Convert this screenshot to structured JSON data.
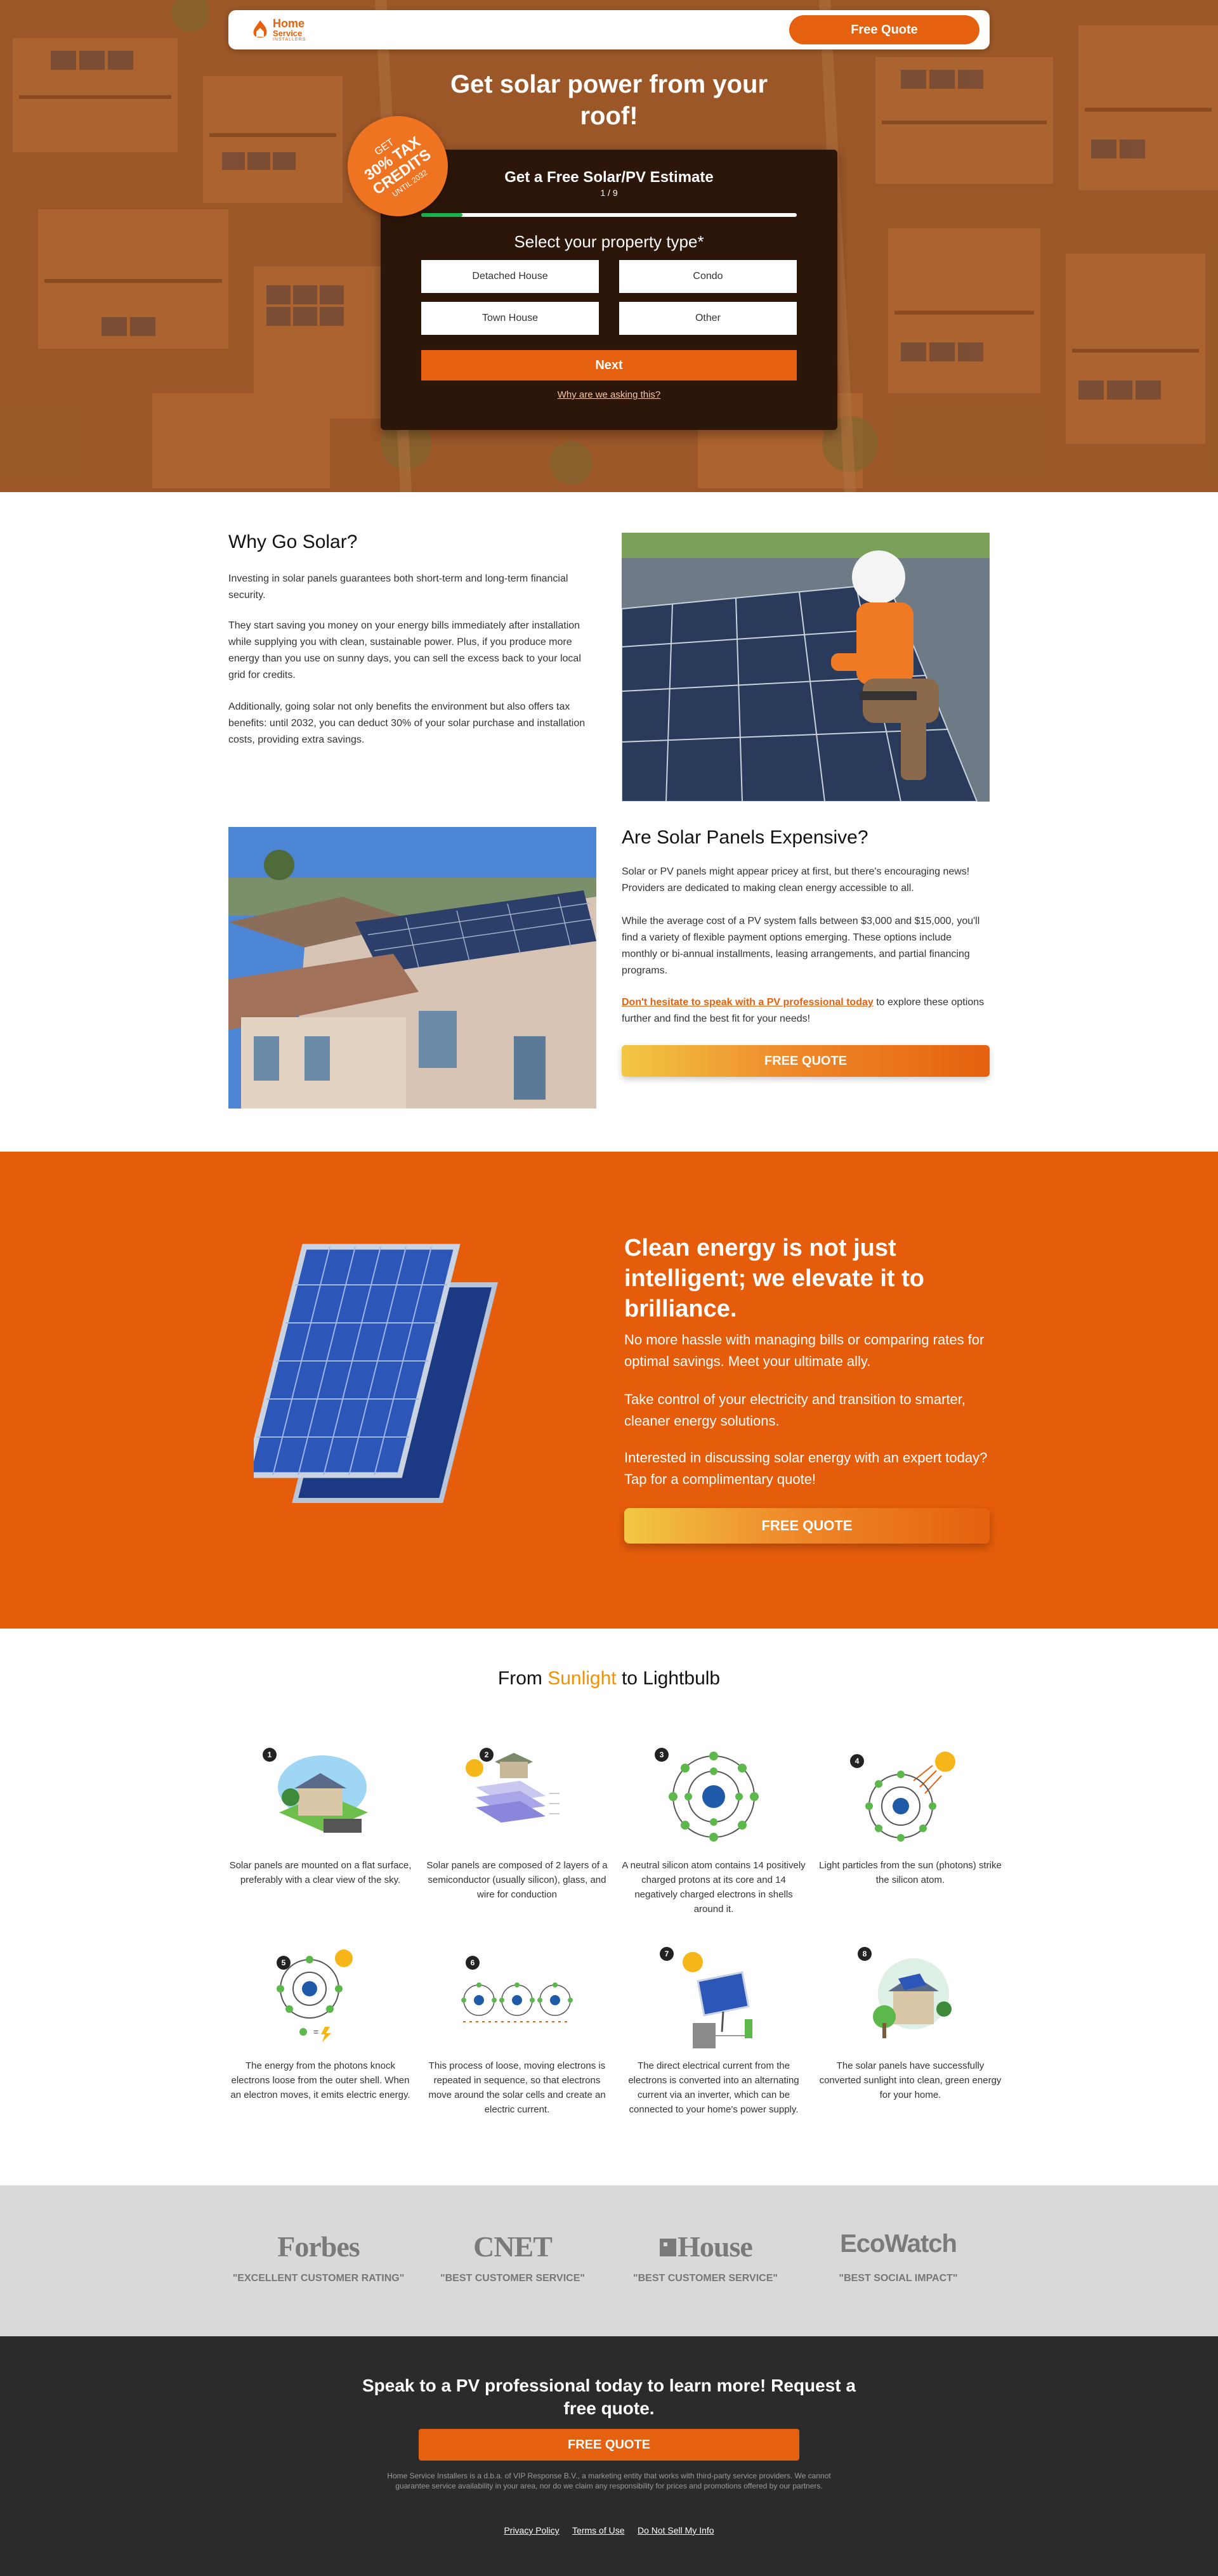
{
  "brand": {
    "name_line1": "Home",
    "name_line2": "Service",
    "name_line3": "INSTALLERS"
  },
  "header": {
    "cta_label": "Free Quote"
  },
  "hero": {
    "title": "Get solar power from your roof!",
    "badge": {
      "line1": "GET",
      "line2": "30% TAX",
      "line3": "CREDITS",
      "line4": "UNTIL 2032"
    },
    "form": {
      "title": "Get a Free Solar/PV Estimate",
      "step": "1 / 9",
      "progress_fraction": 0.11,
      "question": "Select your property type*",
      "options": [
        "Detached House",
        "Condo",
        "Town House",
        "Other"
      ],
      "next_label": "Next",
      "why_label": "Why are we asking this?"
    }
  },
  "why_solar": {
    "title": "Why Go Solar?",
    "p1": "Investing in solar panels guarantees both short-term and long-term financial security.",
    "p2": "They start saving you money on your energy bills immediately after installation while supplying you with clean, sustainable power. Plus, if you produce more energy than you use on sunny days, you can sell the excess back to your local grid for credits.",
    "p3": "Additionally, going solar not only benefits the environment but also offers tax benefits: until 2032, you can deduct 30% of your solar purchase and installation costs, providing extra savings."
  },
  "expensive": {
    "title": "Are Solar Panels Expensive?",
    "p1": "Solar or PV panels might appear pricey at first, but there's encouraging news! Providers are dedicated to making clean energy accessible to all.",
    "p2": "While the average cost of a PV system falls between $3,000 and $15,000, you'll find a variety of flexible payment options emerging. These options include monthly or bi-annual installments, leasing arrangements, and partial financing programs.",
    "p3_link": "Don't hesitate to speak with a PV professional today",
    "p3_rest": " to explore these options further and find the best fit for your needs!",
    "cta_label": "FREE QUOTE"
  },
  "clean_energy": {
    "title": "Clean energy is not just intelligent; we elevate it to brilliance.",
    "p1": "No more hassle with managing bills or comparing rates for optimal savings. Meet your ultimate ally.",
    "p2": "Take control of your electricity and transition to smarter, cleaner energy solutions.",
    "p3": "Interested in discussing solar energy with an expert today? Tap for a complimentary quote!",
    "cta_label": "FREE QUOTE"
  },
  "steps": {
    "title_prefix": "From ",
    "title_highlight": "Sunlight",
    "title_suffix": " to Lightbulb",
    "items": [
      {
        "num": "1",
        "text": "Solar panels are mounted on a flat surface, preferably with a clear view of the sky."
      },
      {
        "num": "2",
        "text": "Solar panels are composed of 2 layers of a semiconductor (usually silicon), glass, and wire for conduction"
      },
      {
        "num": "3",
        "text": "A neutral silicon atom contains 14 positively charged protons at its core and 14 negatively charged electrons in shells around it."
      },
      {
        "num": "4",
        "text": "Light particles from the sun (photons) strike the silicon atom."
      },
      {
        "num": "5",
        "text": "The energy from the photons knock electrons loose from the outer shell. When an electron moves, it emits electric energy."
      },
      {
        "num": "6",
        "text": "This process of loose, moving electrons is repeated in sequence, so that electrons move around the solar cells and create an electric current."
      },
      {
        "num": "7",
        "text": "The direct electrical current from the electrons is converted into an alternating current via an inverter, which can be connected to your home's power supply."
      },
      {
        "num": "8",
        "text": "The solar panels have successfully converted sunlight into clean, green energy for your home."
      }
    ]
  },
  "press": [
    {
      "logo": "Forbes",
      "quote": "\"EXCELLENT CUSTOMER RATING\""
    },
    {
      "logo": "CNET",
      "quote": "\"BEST CUSTOMER SERVICE\""
    },
    {
      "logo": "House",
      "quote": "\"BEST CUSTOMER SERVICE\""
    },
    {
      "logo": "EcoWatch",
      "quote": "\"BEST SOCIAL IMPACT\""
    }
  ],
  "footer": {
    "title": "Speak to a PV professional today to learn more! Request a free quote.",
    "cta_label": "FREE QUOTE",
    "disclaimer": "Home Service Installers is a d.b.a. of VIP Response B.V., a marketing entity that works with third-party service providers. We cannot guarantee service availability in your area, nor do we claim any responsibility for prices and promotions offered by our partners.",
    "links": [
      "Privacy Policy",
      "Terms of Use",
      "Do Not Sell My Info"
    ]
  },
  "colors": {
    "accent": "#e5610f",
    "dark_card": "#2c160a",
    "progress": "#18b34a",
    "footer_bg": "#2b2b2b",
    "press_bg": "#d9d9d9"
  }
}
